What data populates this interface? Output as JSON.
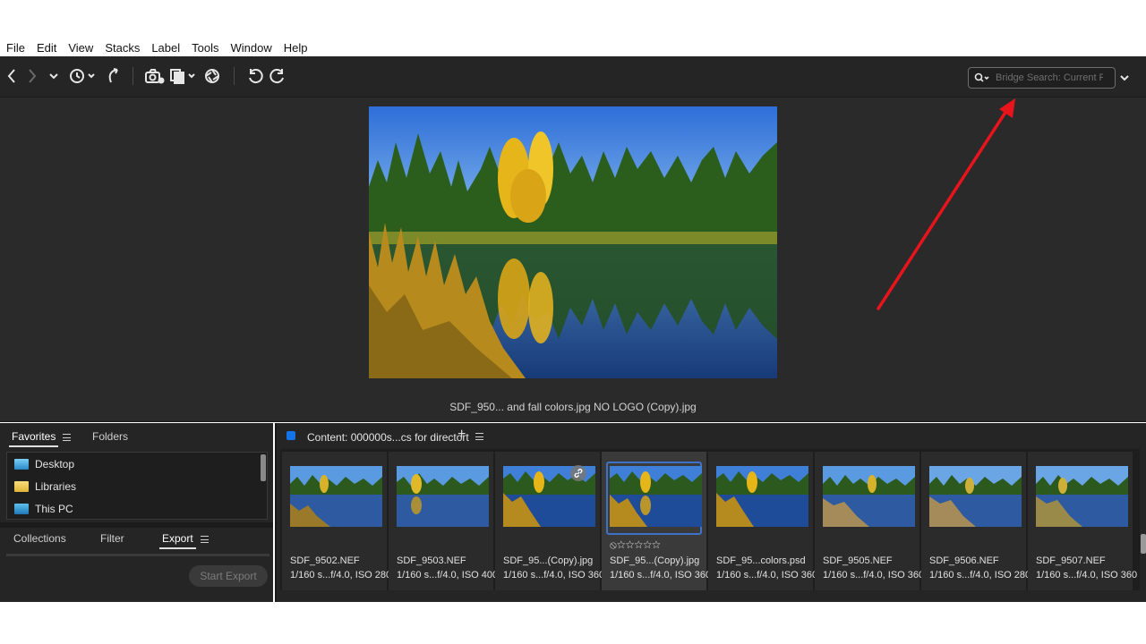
{
  "menu": {
    "items": [
      "File",
      "Edit",
      "View",
      "Stacks",
      "Label",
      "Tools",
      "Window",
      "Help"
    ]
  },
  "toolbar": {
    "icons": [
      "back-arrow-icon",
      "forward-arrow-icon",
      "dropdown-chevron-icon",
      "recent-history-icon",
      "boomerang-icon",
      "camera-import-icon",
      "copy-files-icon",
      "refine-icon",
      "rotate-left-icon",
      "rotate-right-icon"
    ],
    "search_placeholder": "Bridge Search: Current F"
  },
  "preview": {
    "caption": "SDF_950... and fall colors.jpg NO LOGO (Copy).jpg"
  },
  "favorites_panel": {
    "tabs": [
      "Favorites",
      "Folders"
    ],
    "active_tab": "Favorites",
    "items": [
      {
        "label": "Desktop",
        "icon": "desktop-folder-icon",
        "color": "#3aa0d8"
      },
      {
        "label": "Libraries",
        "icon": "libraries-folder-icon",
        "color": "#e8c34a"
      },
      {
        "label": "This PC",
        "icon": "this-pc-icon",
        "color": "#3aa0d8"
      }
    ]
  },
  "export_panel": {
    "tabs": [
      "Collections",
      "Filter",
      "Export"
    ],
    "active_tab": "Export",
    "start_export_label": "Start Export"
  },
  "content_panel": {
    "title": "Content: 000000s...cs for directort",
    "accent": "#1473e6",
    "thumbnails": [
      {
        "name": "SDF_9502.NEF",
        "meta": "1/160 s...f/4.0, ISO 280"
      },
      {
        "name": "SDF_9503.NEF",
        "meta": "1/160 s...f/4.0, ISO 400"
      },
      {
        "name": "SDF_95...(Copy).jpg",
        "meta": "1/160 s...f/4.0, ISO 360"
      },
      {
        "name": "SDF_95...(Copy).jpg",
        "meta": "1/160 s...f/4.0, ISO 360",
        "rating": "⦸☆☆☆☆☆"
      },
      {
        "name": "SDF_95...colors.psd",
        "meta": "1/160 s...f/4.0, ISO 360"
      },
      {
        "name": "SDF_9505.NEF",
        "meta": "1/160 s...f/4.0, ISO 360"
      },
      {
        "name": "SDF_9506.NEF",
        "meta": "1/160 s...f/4.0, ISO 280"
      },
      {
        "name": "SDF_9507.NEF",
        "meta": "1/160 s...f/4.0, ISO 360"
      }
    ]
  },
  "colors": {
    "annotation_arrow": "#e8141c",
    "selection_border": "#3e72c8"
  }
}
